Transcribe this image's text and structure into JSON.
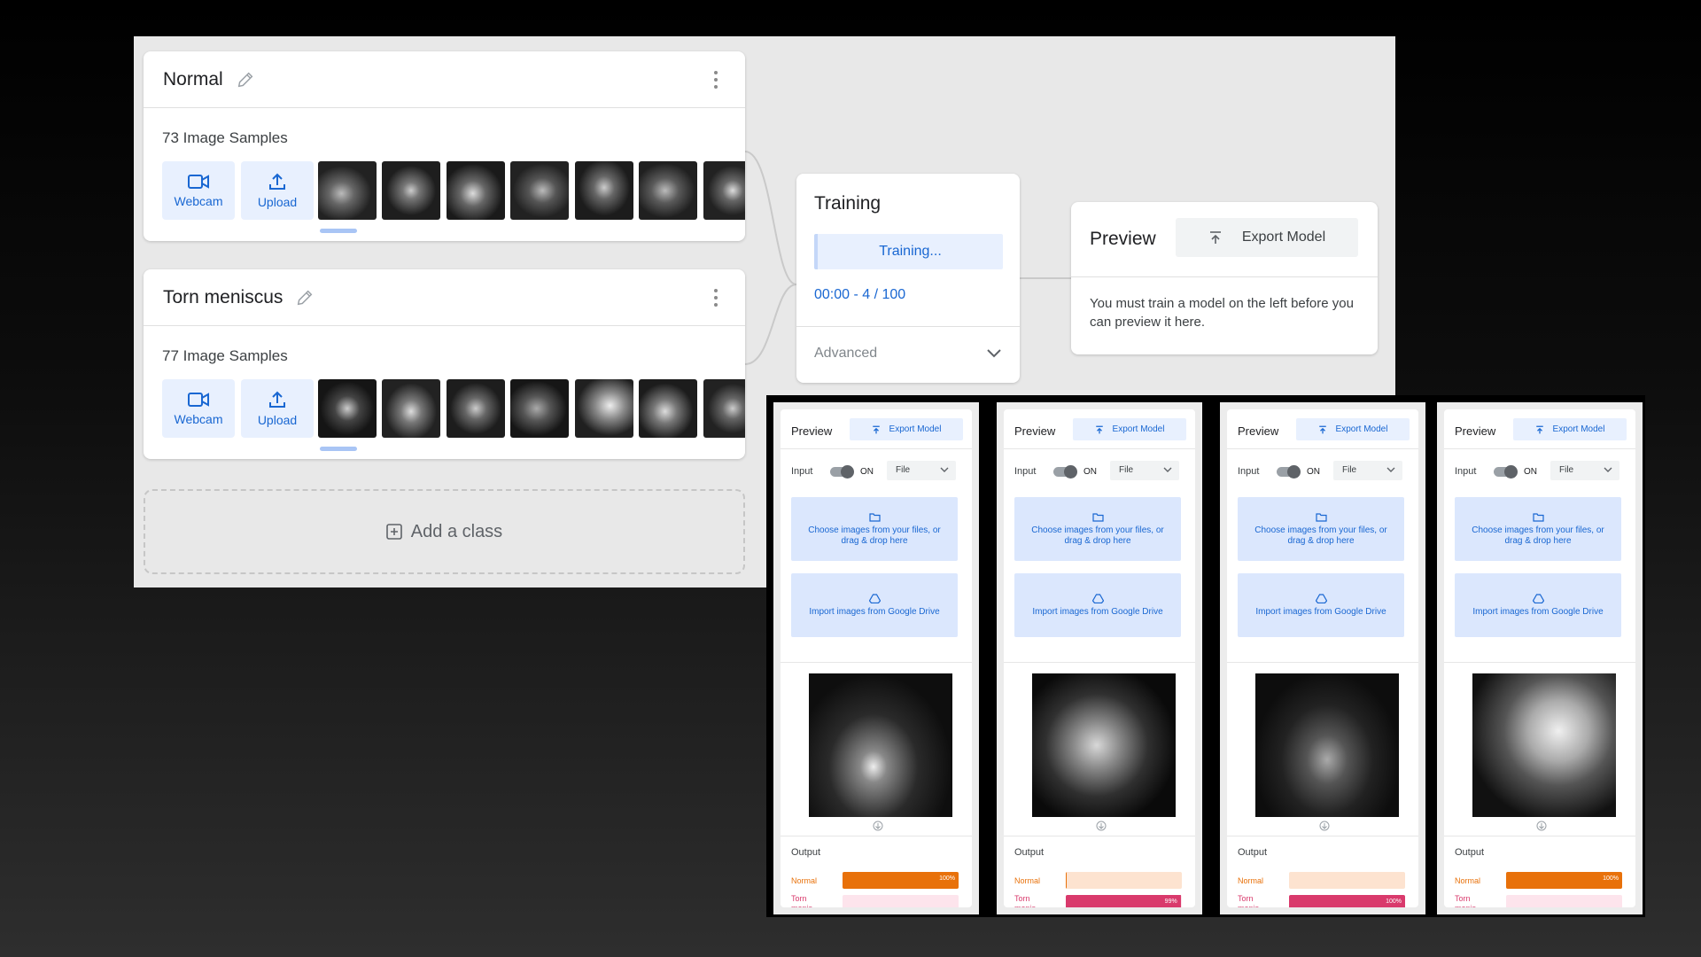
{
  "classes": [
    {
      "name": "Normal",
      "samples": "73 Image Samples",
      "webcam": "Webcam",
      "upload": "Upload"
    },
    {
      "name": "Torn meniscus",
      "samples": "77 Image Samples",
      "webcam": "Webcam",
      "upload": "Upload"
    }
  ],
  "add_class": "Add a class",
  "training": {
    "title": "Training",
    "button": "Training...",
    "progress": "00:00 - 4 / 100",
    "advanced": "Advanced"
  },
  "preview": {
    "title": "Preview",
    "export": "Export Model",
    "message": "You must train a model on the left before you can preview it here."
  },
  "mini_previews": [
    {
      "title": "Preview",
      "export": "Export Model",
      "input_label": "Input",
      "toggle": "ON",
      "source": "File",
      "drop_text": "Choose images from your files, or drag & drop here",
      "drive_text": "Import images from Google Drive",
      "output_label": "Output",
      "label_normal": "Normal",
      "label_torn": "Torn menis...",
      "normal_value": 1.0,
      "normal_pct": "100%",
      "torn_value": 0.0,
      "torn_pct": ""
    },
    {
      "title": "Preview",
      "export": "Export Model",
      "input_label": "Input",
      "toggle": "ON",
      "source": "File",
      "drop_text": "Choose images from your files, or drag & drop here",
      "drive_text": "Import images from Google Drive",
      "output_label": "Output",
      "label_normal": "Normal",
      "label_torn": "Torn menis...",
      "normal_value": 0.01,
      "normal_pct": "",
      "torn_value": 0.99,
      "torn_pct": "99%"
    },
    {
      "title": "Preview",
      "export": "Export Model",
      "input_label": "Input",
      "toggle": "ON",
      "source": "File",
      "drop_text": "Choose images from your files, or drag & drop here",
      "drive_text": "Import images from Google Drive",
      "output_label": "Output",
      "label_normal": "Normal",
      "label_torn": "Torn menis...",
      "normal_value": 0.0,
      "normal_pct": "",
      "torn_value": 1.0,
      "torn_pct": "100%"
    },
    {
      "title": "Preview",
      "export": "Export Model",
      "input_label": "Input",
      "toggle": "ON",
      "source": "File",
      "drop_text": "Choose images from your files, or drag & drop here",
      "drive_text": "Import images from Google Drive",
      "output_label": "Output",
      "label_normal": "Normal",
      "label_torn": "Torn menis...",
      "normal_value": 1.0,
      "normal_pct": "100%",
      "torn_value": 0.0,
      "torn_pct": ""
    }
  ],
  "colors": {
    "accent_blue": "#1967d2",
    "light_blue": "#e8f0fe",
    "normal_orange": "#e8710a",
    "torn_pink": "#d93a6c"
  },
  "icons": [
    "pencil-icon",
    "more-vert-icon",
    "webcam-icon",
    "upload-icon",
    "add-box-icon",
    "chevron-down-icon",
    "export-icon",
    "folder-icon",
    "drive-icon",
    "arrow-down-icon"
  ]
}
